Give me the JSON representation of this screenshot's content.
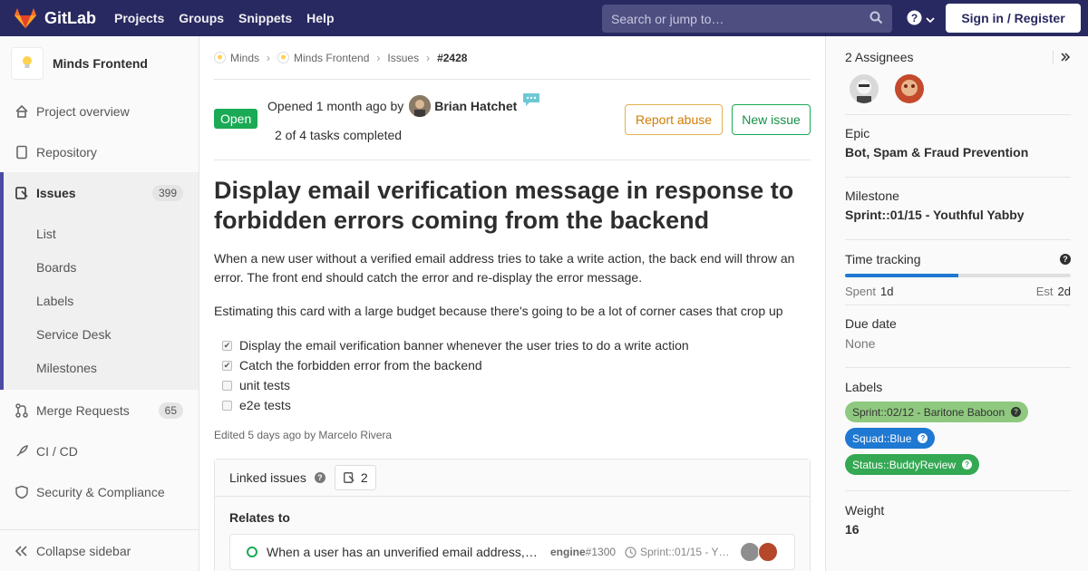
{
  "navbar": {
    "brand": "GitLab",
    "links": [
      "Projects",
      "Groups",
      "Snippets",
      "Help"
    ],
    "search_placeholder": "Search or jump to…",
    "sign_in": "Sign in / Register"
  },
  "sidebar": {
    "project_name": "Minds Frontend",
    "items": [
      {
        "label": "Project overview",
        "icon": "home-icon"
      },
      {
        "label": "Repository",
        "icon": "doc-icon"
      },
      {
        "label": "Issues",
        "icon": "issues-icon",
        "count": "399",
        "active": true
      },
      {
        "label": "Merge Requests",
        "icon": "merge-request-icon",
        "count": "65"
      },
      {
        "label": "CI / CD",
        "icon": "rocket-icon"
      },
      {
        "label": "Security & Compliance",
        "icon": "shield-icon"
      }
    ],
    "sub_items": [
      "List",
      "Boards",
      "Labels",
      "Service Desk",
      "Milestones"
    ],
    "collapse": "Collapse sidebar"
  },
  "breadcrumb": {
    "items": [
      "Minds",
      "Minds Frontend",
      "Issues"
    ],
    "current": "#2428"
  },
  "issue": {
    "status": "Open",
    "opened_prefix": "Opened",
    "opened_time": "1 month ago",
    "opened_by": "by",
    "author": "Brian Hatchet",
    "tasks": "2 of 4 tasks completed",
    "report_abuse": "Report abuse",
    "new_issue": "New issue",
    "title": "Display email verification message in response to forbidden errors coming from the backend",
    "description_1": "When a new user without a verified email address tries to take a write action, the back end will throw an error. The front end should catch the error and re-display the error message.",
    "description_2": "Estimating this card with a large budget because there's going to be a lot of corner cases that crop up",
    "task_list": [
      {
        "label": "Display the email verification banner whenever the user tries to do a write action",
        "checked": true
      },
      {
        "label": "Catch the forbidden error from the backend",
        "checked": true
      },
      {
        "label": "unit tests",
        "checked": false
      },
      {
        "label": "e2e tests",
        "checked": false
      }
    ],
    "edited": "Edited 5 days ago by Marcelo Rivera"
  },
  "linked": {
    "title": "Linked issues",
    "count": "2",
    "relates_to": "Relates to",
    "item": {
      "title": "When a user has an unverified email address,…",
      "ref_project": "engine",
      "ref_number": "#1300",
      "milestone": "Sprint::01/15 - Y…"
    }
  },
  "right": {
    "assignees": "2 Assignees",
    "epic_label": "Epic",
    "epic": "Bot, Spam & Fraud Prevention",
    "milestone_label": "Milestone",
    "milestone": "Sprint::01/15 - Youthful Yabby",
    "time_label": "Time tracking",
    "spent_label": "Spent",
    "spent": "1d",
    "est_label": "Est",
    "est": "2d",
    "time_progress": 0.5,
    "due_label": "Due date",
    "due": "None",
    "labels_label": "Labels",
    "labels": [
      {
        "text": "Sprint::02/12 - Baritone Baboon",
        "bg": "#8fc97f",
        "fg": "#333333"
      },
      {
        "text": "Squad::Blue",
        "bg": "#1f78d1",
        "fg": "#ffffff"
      },
      {
        "text": "Status::BuddyReview",
        "bg": "#34a853",
        "fg": "#ffffff"
      }
    ],
    "weight_label": "Weight",
    "weight": "16"
  },
  "colors": {
    "navbar": "#292961",
    "open": "#1aaa55",
    "accent": "#4b4ba3"
  }
}
